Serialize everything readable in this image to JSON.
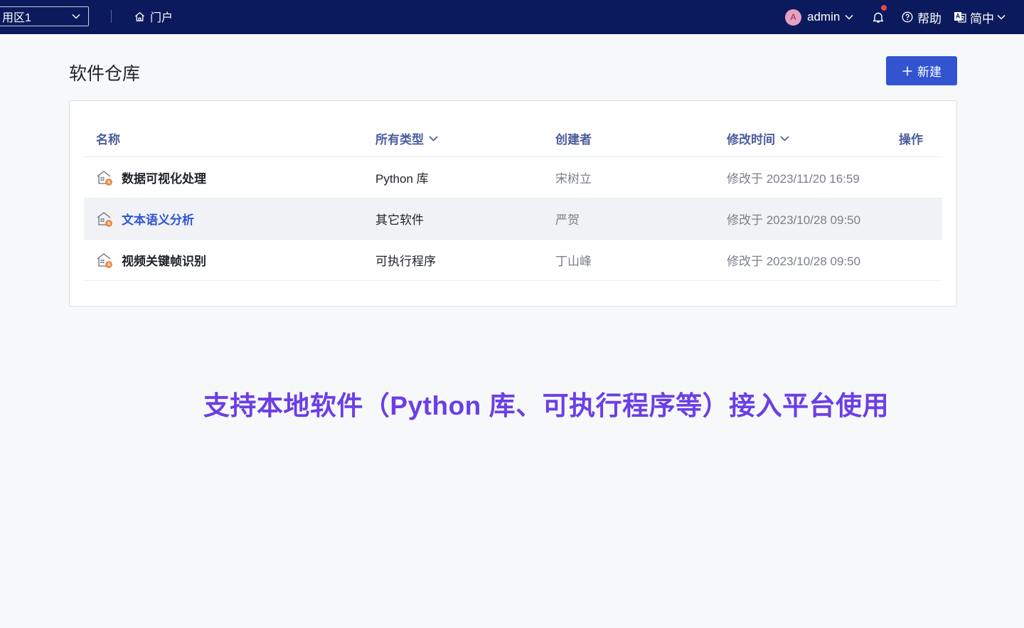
{
  "topbar": {
    "workspace": "用区1",
    "portal_label": "门户",
    "user_initial": "A",
    "user_name": "admin",
    "help_label": "帮助",
    "lang_label": "简中"
  },
  "page": {
    "title": "软件仓库",
    "new_button_label": "新建"
  },
  "table": {
    "headers": {
      "name": "名称",
      "type": "所有类型",
      "creator": "创建者",
      "modified": "修改时间",
      "actions": "操作"
    },
    "rows": [
      {
        "name": "数据可视化处理",
        "type": "Python 库",
        "creator": "宋树立",
        "modified": "修改于 2023/11/20 16:59"
      },
      {
        "name": "文本语义分析",
        "type": "其它软件",
        "creator": "严贺",
        "modified": "修改于 2023/10/28 09:50"
      },
      {
        "name": "视频关键帧识别",
        "type": "可执行程序",
        "creator": "丁山峰",
        "modified": "修改于 2023/10/28 09:50"
      }
    ]
  },
  "caption": "支持本地软件（Python 库、可执行程序等）接入平台使用",
  "colors": {
    "topbar": "#0b1a5c",
    "primary": "#3254d1",
    "caption": "#6a3fe6",
    "notification_dot": "#e5484d"
  },
  "icons": [
    "chevron-down-icon",
    "home-icon",
    "bell-icon",
    "help-circle-icon",
    "translate-icon",
    "plus-icon",
    "software-package-icon"
  ]
}
